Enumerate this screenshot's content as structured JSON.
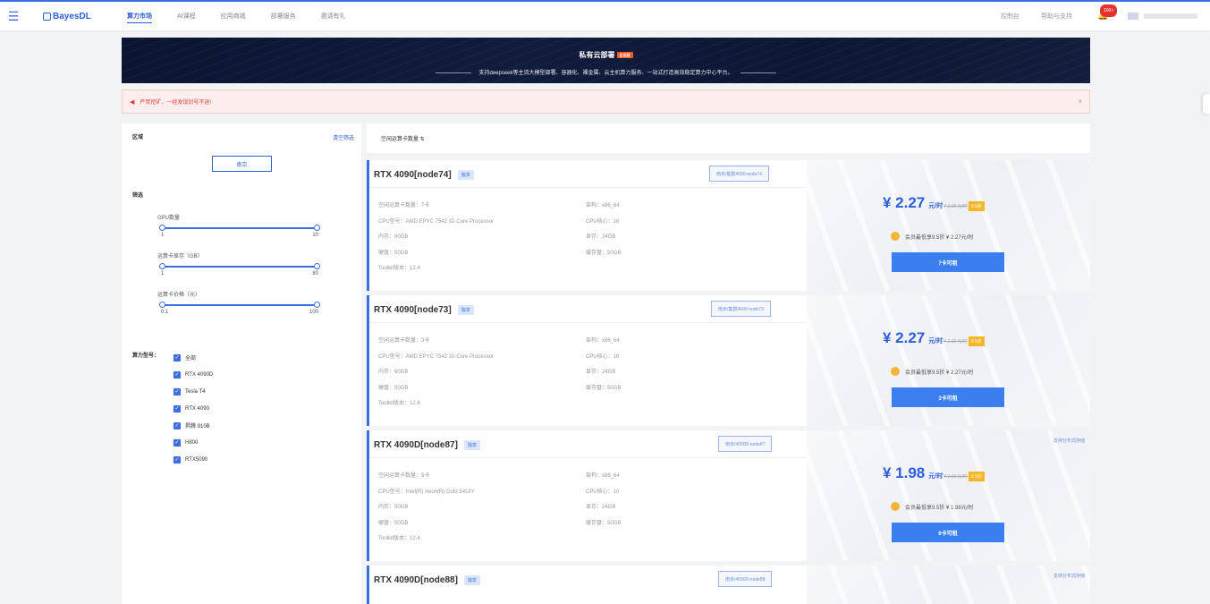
{
  "header": {
    "logo": "BayesDL",
    "nav": [
      "算力市场",
      "AI课程",
      "应用商城",
      "部署服务",
      "邀请有礼"
    ],
    "right_links": [
      "控制台",
      "帮助与支持"
    ],
    "badge": "100+"
  },
  "banner": {
    "title": "私有云部署",
    "tag": "企业版",
    "subtitle": "支持deepseek等主流大模型部署、容器化、裸金属、云主机算力服务、一站式打造高效稳定算力中心平台。"
  },
  "notice": {
    "text": "严禁挖矿，一经发现封号不退!",
    "close": "×"
  },
  "filter": {
    "region_title": "区域",
    "clear": "清空筛选",
    "region_button": "南京",
    "filter_title": "筛选",
    "sliders": [
      {
        "label": "GPU数量",
        "min": "1",
        "max": "10"
      },
      {
        "label": "运算卡显存（GB）",
        "min": "1",
        "max": "80"
      },
      {
        "label": "运算卡价格（元）",
        "min": "0.1",
        "max": "100"
      }
    ],
    "model_title": "算力型号：",
    "models": [
      "全部",
      "RTX 4090D",
      "Tesla T4",
      "RTX 4090",
      "昇腾 910B",
      "H800",
      "RTX5090"
    ]
  },
  "sort": {
    "label": "空闲运算卡数量 ⇅"
  },
  "cards": [
    {
      "name": "RTX 4090[node74]",
      "tag": "独享",
      "id": "南京/集群4090-node74",
      "specs": [
        [
          "空闲运算卡数量：7卡",
          "架构：x86_64"
        ],
        [
          "CPU型号：AMD EPYC 7542 32-Core Processor",
          "CPU核心：16"
        ],
        [
          "内存：60GB",
          "显存：24GB"
        ],
        [
          "硬盘：50GB",
          "缓存盘：50GB"
        ],
        [
          "Toolkit版本：12.4",
          ""
        ]
      ],
      "price": "¥ 2.27",
      "unit": "元/时",
      "old_price": "¥ 2.38 元/时",
      "discount": "9.5折",
      "member": "会员最低享9.5折  ¥ 2.27元/时",
      "button": "7卡可租",
      "dist": ""
    },
    {
      "name": "RTX 4090[node73]",
      "tag": "独享",
      "id": "南京/集群4090-node73",
      "specs": [
        [
          "空闲运算卡数量：3卡",
          "架构：x86_64"
        ],
        [
          "CPU型号：AMD EPYC 7542 32-Core Processor",
          "CPU核心：16"
        ],
        [
          "内存：60GB",
          "显存：24GB"
        ],
        [
          "硬盘：50GB",
          "缓存盘：50GB"
        ],
        [
          "Toolkit版本：12.4",
          ""
        ]
      ],
      "price": "¥ 2.27",
      "unit": "元/时",
      "old_price": "¥ 2.38 元/时",
      "discount": "9.5折",
      "member": "会员最低享9.5折  ¥ 2.27元/时",
      "button": "3卡可租",
      "dist": ""
    },
    {
      "name": "RTX 4090D[node87]",
      "tag": "独享",
      "id": "南京/4090D-node87",
      "specs": [
        [
          "空闲运算卡数量：5卡",
          "架构：x86_64"
        ],
        [
          "CPU型号：Intel(R) Xeon(R) Gold 5418Y",
          "CPU核心：10"
        ],
        [
          "内存：50GB",
          "显存：24GB"
        ],
        [
          "硬盘：50GB",
          "缓存盘：50GB"
        ],
        [
          "Toolkit版本：12.4",
          ""
        ]
      ],
      "price": "¥ 1.98",
      "unit": "元/时",
      "old_price": "¥ 2.08 元/时",
      "discount": "9.5折",
      "member": "会员最低享9.5折  ¥ 1.98元/时",
      "button": "6卡可租",
      "dist": "支持分布式存储"
    },
    {
      "name": "RTX 4090D[node88]",
      "tag": "独享",
      "id": "南京/4090D-node88",
      "specs": [],
      "price": "",
      "unit": "",
      "old_price": "",
      "discount": "",
      "member": "",
      "button": "",
      "dist": "支持分布式存储"
    }
  ]
}
